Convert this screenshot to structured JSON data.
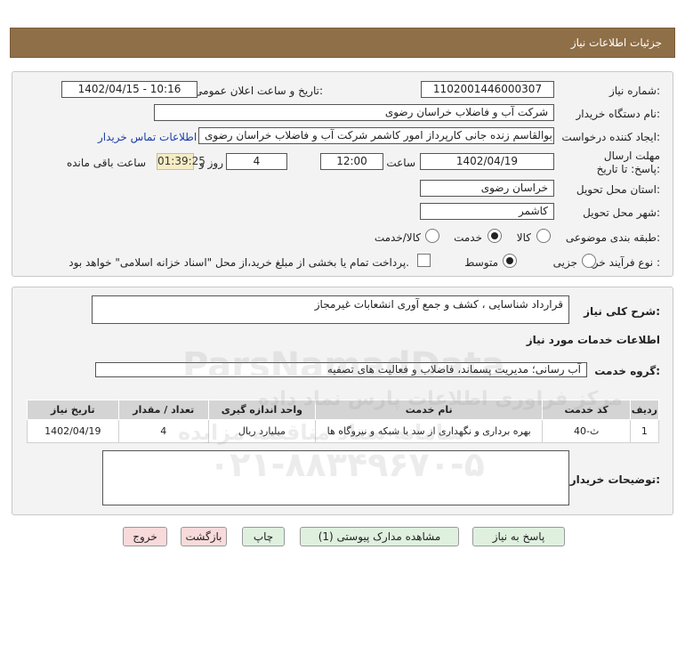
{
  "header": {
    "title": "جزئیات اطلاعات نیاز"
  },
  "form": {
    "need_number_label": "شماره نیاز:",
    "need_number": "1102001446000307",
    "announce_label": "تاریخ و ساعت اعلان عمومی:",
    "announce_value": "1402/04/15 - 10:16",
    "buyer_org_label": "نام دستگاه خریدار:",
    "buyer_org": "شرکت آب و فاضلاب خراسان رضوی",
    "requester_label": "ایجاد کننده درخواست:",
    "requester": "ابوالقاسم زنده جانی کارپرداز امور کاشمر  شرکت آب و فاضلاب خراسان رضوی",
    "contact_link": "اطلاعات تماس خریدار",
    "deadline_label": "مهلت ارسال پاسخ: تا تاریخ:",
    "deadline_date": "1402/04/19",
    "time_label": "ساعت",
    "deadline_time": "12:00",
    "days_value": "4",
    "days_label": "روز و",
    "remaining_time": "01:39:25",
    "remaining_label": "ساعت باقی مانده",
    "province_label": "استان محل تحویل:",
    "province": "خراسان رضوی",
    "city_label": "شهر محل تحویل:",
    "city": "کاشمر",
    "category_label": "طبقه بندی موضوعی:",
    "category_options": [
      "کالا",
      "خدمت",
      "کالا/خدمت"
    ],
    "category_selected": "خدمت",
    "process_label": "نوع فرآیند خرید :",
    "process_options": [
      "جزیی",
      "متوسط"
    ],
    "process_selected": "متوسط",
    "payment_note": "پرداخت تمام یا بخشی از مبلغ خرید،از محل \"اسناد خزانه اسلامی\" خواهد بود."
  },
  "details": {
    "summary_label": "شرح کلی نیاز:",
    "summary": "قرارداد شناسایی ، کشف و جمع آوری انشعابات غیرمجاز",
    "services_heading": "اطلاعات خدمات مورد نیاز",
    "service_group_label": "گروه خدمت:",
    "service_group": "آب رسانی؛ مدیریت پسماند، فاضلاب و فعالیت های تصفیه",
    "table": {
      "headers": [
        "ردیف",
        "کد خدمت",
        "نام خدمت",
        "واحد اندازه گیری",
        "تعداد / مقدار",
        "تاریخ نیاز"
      ],
      "rows": [
        [
          "1",
          "ث-40",
          "بهره برداری و نگهداری از سد یا شبکه و نیروگاه ها",
          "میلیارد ریال",
          "4",
          "1402/04/19"
        ]
      ]
    },
    "buyer_notes_label": "توضیحات خریدار:",
    "buyer_notes": ""
  },
  "buttons": {
    "reply": "پاسخ به نیاز",
    "attachments": "مشاهده مدارک پیوستی (1)",
    "print": "چاپ",
    "back": "بازگشت",
    "exit": "خروج"
  },
  "watermark": {
    "brand": "ParsNamadData",
    "line1": "مرکز فراوری اطلاعات پارس نماد داده",
    "line2": "سامانه ستاد مناقصه مزایده",
    "phone": "۰۲۱-۸۸۳۴۹۶۷۰-۵"
  }
}
